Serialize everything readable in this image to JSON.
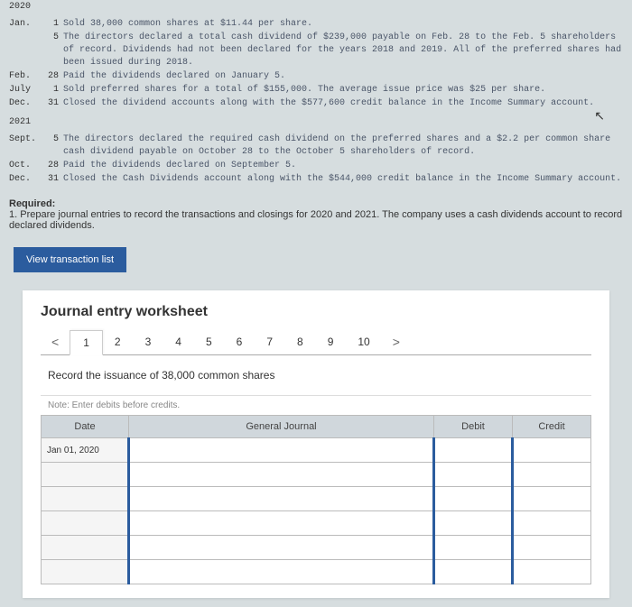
{
  "year2020": "2020",
  "year2021": "2021",
  "transactions2020": [
    {
      "month": "Jan.",
      "day": "1",
      "text": "Sold 38,000 common shares at $11.44 per share."
    },
    {
      "month": "",
      "day": "5",
      "text": "The directors declared a total cash dividend of $239,000 payable on Feb. 28 to the Feb. 5 shareholders of record. Dividends had not been declared for the years 2018 and 2019. All of the preferred shares had been issued during 2018."
    },
    {
      "month": "Feb.",
      "day": "28",
      "text": "Paid the dividends declared on January 5."
    },
    {
      "month": "July",
      "day": "1",
      "text": "Sold preferred shares for a total of $155,000. The average issue price was $25 per share."
    },
    {
      "month": "Dec.",
      "day": "31",
      "text": "Closed the dividend accounts along with the $577,600 credit balance in the Income Summary account."
    }
  ],
  "transactions2021": [
    {
      "month": "Sept.",
      "day": "5",
      "text": "The directors declared the required cash dividend on the preferred shares and a $2.2 per common share cash dividend payable on October 28 to the October 5 shareholders of record."
    },
    {
      "month": "Oct.",
      "day": "28",
      "text": "Paid the dividends declared on September 5."
    },
    {
      "month": "Dec.",
      "day": "31",
      "text": "Closed the Cash Dividends account along with the $544,000 credit balance in the Income Summary account."
    }
  ],
  "required": {
    "title": "Required:",
    "text": "1. Prepare journal entries to record the transactions and closings for 2020 and 2021. The company uses a cash dividends account to record declared dividends."
  },
  "viewBtn": "View transaction list",
  "worksheet": {
    "title": "Journal entry worksheet",
    "tabs": [
      "1",
      "2",
      "3",
      "4",
      "5",
      "6",
      "7",
      "8",
      "9",
      "10"
    ],
    "instruction": "Record the issuance of 38,000 common shares",
    "note": "Note: Enter debits before credits.",
    "headers": {
      "date": "Date",
      "gj": "General Journal",
      "debit": "Debit",
      "credit": "Credit"
    },
    "firstDate": "Jan 01, 2020"
  }
}
